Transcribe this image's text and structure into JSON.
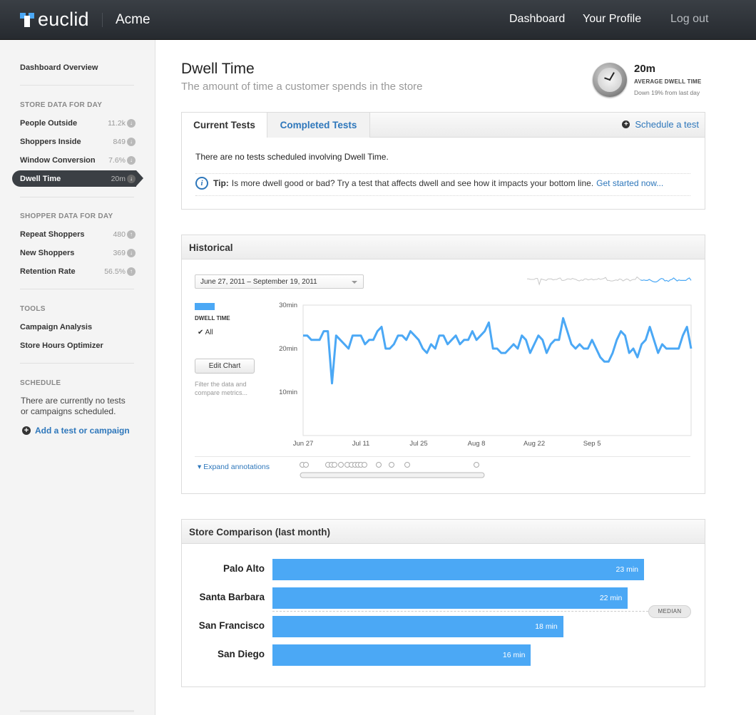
{
  "topbar": {
    "brand": "euclid",
    "org": "Acme",
    "nav": {
      "dashboard": "Dashboard",
      "profile": "Your Profile",
      "logout": "Log out"
    }
  },
  "sidebar": {
    "overview": "Dashboard Overview",
    "store_heading": "STORE DATA FOR DAY",
    "store_items": [
      {
        "label": "People Outside",
        "value": "11.2k",
        "trend": "down"
      },
      {
        "label": "Shoppers Inside",
        "value": "849",
        "trend": "down"
      },
      {
        "label": "Window Conversion",
        "value": "7.6%",
        "trend": "down"
      },
      {
        "label": "Dwell Time",
        "value": "20m",
        "trend": "down",
        "active": true
      }
    ],
    "shopper_heading": "SHOPPER DATA FOR DAY",
    "shopper_items": [
      {
        "label": "Repeat Shoppers",
        "value": "480",
        "trend": "up"
      },
      {
        "label": "New Shoppers",
        "value": "369",
        "trend": "down"
      },
      {
        "label": "Retention Rate",
        "value": "56.5%",
        "trend": "up"
      }
    ],
    "tools_heading": "TOOLS",
    "tools": [
      "Campaign Analysis",
      "Store Hours Optimizer"
    ],
    "schedule_heading": "SCHEDULE",
    "schedule_text": "There are currently no tests or campaigns scheduled.",
    "schedule_link": "Add a test or campaign"
  },
  "page": {
    "title": "Dwell Time",
    "subtitle": "The amount of time a customer spends in the store"
  },
  "stat": {
    "value": "20m",
    "label": "AVERAGE DWELL TIME",
    "delta": "Down 19% from last day",
    "icon": "clock-icon"
  },
  "tests": {
    "tab_current": "Current Tests",
    "tab_completed": "Completed Tests",
    "schedule_link": "Schedule a test",
    "empty_text": "There are no tests scheduled involving Dwell Time.",
    "tip_label": "Tip:",
    "tip_text": "Is more dwell good or bad? Try a test that affects dwell and see how it impacts your bottom line.",
    "tip_link": "Get started now..."
  },
  "historical": {
    "title": "Historical",
    "date_range": "June 27, 2011 – September 19, 2011",
    "legend_name": "DWELL TIME",
    "legend_all": "All",
    "edit_button": "Edit Chart",
    "filter_help": "Filter the data and compare metrics...",
    "expand_annotations": "Expand annotations"
  },
  "chart_data": {
    "type": "line",
    "series": [
      {
        "name": "DWELL TIME",
        "color": "#4ba8f5",
        "values": [
          23,
          23,
          22,
          22,
          22,
          24,
          24,
          12,
          23,
          22,
          21,
          20,
          23,
          23,
          23,
          21,
          22,
          22,
          24,
          25,
          20,
          20,
          21,
          23,
          23,
          22,
          24,
          23,
          22,
          20,
          19,
          21,
          20,
          23,
          23,
          21,
          22,
          23,
          21,
          22,
          22,
          24,
          22,
          23,
          24,
          26,
          20,
          20,
          19,
          19,
          20,
          21,
          20,
          23,
          22,
          19,
          21,
          23,
          22,
          19,
          21,
          22,
          22,
          27,
          24,
          21,
          20,
          21,
          20,
          20,
          22,
          20,
          18,
          17,
          17,
          19,
          22,
          24,
          23,
          19,
          20,
          18,
          21,
          22,
          25,
          22,
          19,
          21,
          20,
          20,
          20,
          20,
          23,
          25,
          20
        ]
      }
    ],
    "x_tick_labels": [
      "Jun 27",
      "Jul 11",
      "Jul 25",
      "Aug 8",
      "Aug 22",
      "Sep 5"
    ],
    "y_tick_labels": [
      "30min",
      "20min",
      "10min"
    ],
    "ylim": [
      0,
      30
    ],
    "grid": false
  },
  "comparison": {
    "title": "Store Comparison (last month)",
    "median_label": "MEDIAN",
    "median_value": 20,
    "max_value": 23,
    "stores": [
      {
        "name": "Palo Alto",
        "value": 23,
        "label": "23 min"
      },
      {
        "name": "Santa Barbara",
        "value": 22,
        "label": "22 min"
      },
      {
        "name": "San Francisco",
        "value": 18,
        "label": "18 min"
      },
      {
        "name": "San Diego",
        "value": 16,
        "label": "16 min"
      }
    ]
  }
}
